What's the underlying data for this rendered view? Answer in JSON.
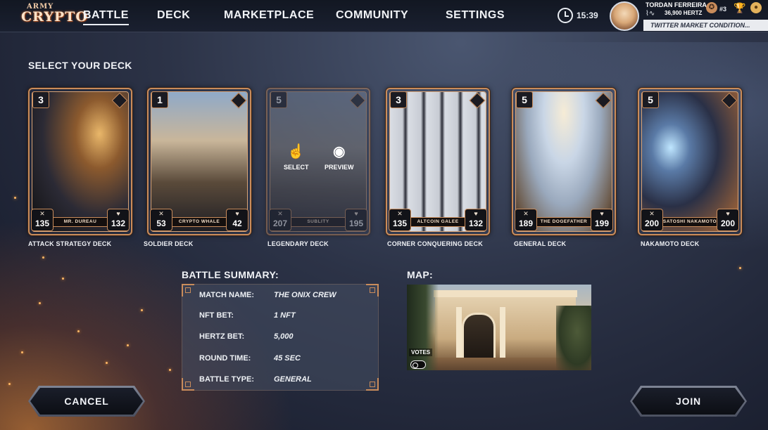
{
  "app": {
    "logo_line1": "ARMY",
    "logo_line2": "CRYPTO"
  },
  "nav": {
    "items": [
      {
        "label": "BATTLE",
        "active": true
      },
      {
        "label": "DECK",
        "active": false
      },
      {
        "label": "MARKETPLACE",
        "active": false
      },
      {
        "label": "COMMUNITY",
        "active": false
      },
      {
        "label": "SETTINGS",
        "active": false
      }
    ]
  },
  "status": {
    "time": "15:39",
    "user_name": "TORDAN FERREIRA",
    "hertz": "36,900 HERTZ",
    "rank": "#3",
    "ticker": "TWITTER MARKET CONDITION..."
  },
  "select_title": "SELECT YOUR DECK",
  "decks": [
    {
      "cost": "3",
      "attack": "135",
      "health": "132",
      "card_name": "MR. DUREAU",
      "label": "ATTACK STRATEGY DECK",
      "faded": false
    },
    {
      "cost": "1",
      "attack": "53",
      "health": "42",
      "card_name": "CRYPTO WHALE",
      "label": "SOLDIER DECK",
      "faded": false
    },
    {
      "cost": "5",
      "attack": "207",
      "health": "195",
      "card_name": "SUBLITY",
      "label": "LEGENDARY DECK",
      "faded": true
    },
    {
      "cost": "3",
      "attack": "135",
      "health": "132",
      "card_name": "ALTCOIN GALEE",
      "label": "CORNER CONQUERING DECK",
      "faded": false
    },
    {
      "cost": "5",
      "attack": "189",
      "health": "199",
      "card_name": "THE DOGEFATHER",
      "label": "GENERAL DECK",
      "faded": false
    },
    {
      "cost": "5",
      "attack": "200",
      "health": "200",
      "card_name": "SATOSHI NAKAMOTO",
      "label": "NAKAMOTO DECK",
      "faded": false
    }
  ],
  "overlay": {
    "select_label": "SELECT",
    "preview_label": "PREVIEW"
  },
  "summary": {
    "title": "BATTLE SUMMARY:",
    "rows": [
      {
        "label": "MATCH NAME:",
        "value": "THE ONIX CREW"
      },
      {
        "label": "NFT BET:",
        "value": "1 NFT"
      },
      {
        "label": "HERTZ BET:",
        "value": "5,000"
      },
      {
        "label": "ROUND TIME:",
        "value": "45 SEC"
      },
      {
        "label": "BATTLE TYPE:",
        "value": "GENERAL"
      }
    ]
  },
  "map": {
    "title": "MAP:",
    "votes_label": "VOTES"
  },
  "buttons": {
    "cancel": "CANCEL",
    "join": "JOIN"
  },
  "colors": {
    "accent": "#c98c5b",
    "background": "#2c3347",
    "ticker_bg": "#e9ebef"
  }
}
